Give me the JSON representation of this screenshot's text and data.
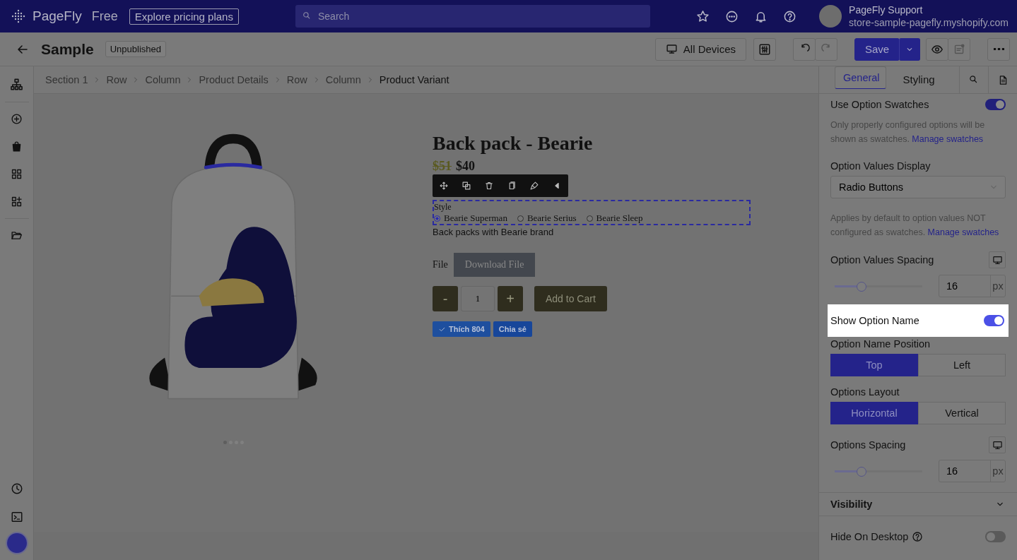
{
  "topbar": {
    "logo": "PageFly",
    "plan": "Free",
    "pricing_button": "Explore pricing plans",
    "search": {
      "placeholder": "Search"
    },
    "user": {
      "name": "PageFly Support",
      "store": "store-sample-pagefly.myshopify.com"
    }
  },
  "toolbar": {
    "page_title": "Sample",
    "status": "Unpublished",
    "device_button": "All Devices",
    "save_button": "Save"
  },
  "breadcrumb": [
    "Section 1",
    "Row",
    "Column",
    "Product Details",
    "Row",
    "Column",
    "Product Variant"
  ],
  "product": {
    "title": "Back pack - Bearie",
    "compare_price": "$51",
    "price": "$40",
    "option_name": "Style",
    "options": [
      {
        "label": "Bearie Superman",
        "selected": true
      },
      {
        "label": "Bearie Serius",
        "selected": false
      },
      {
        "label": "Bearie Sleep",
        "selected": false
      }
    ],
    "description": "Back packs with Bearie brand",
    "file_label": "File",
    "download_button": "Download File",
    "minus": "-",
    "quantity": "1",
    "plus": "+",
    "add_to_cart": "Add to Cart",
    "like_button": "Thích 804",
    "share_button": "Chia sẻ",
    "gallery_dots": [
      {
        "selected": true
      },
      {
        "selected": false
      },
      {
        "selected": false
      },
      {
        "selected": false
      }
    ]
  },
  "panel": {
    "tabs": [
      {
        "label": "General",
        "selected": true
      },
      {
        "label": "Styling",
        "selected": false
      }
    ],
    "settings": [
      {
        "kind": "toggle",
        "label": "Use Option Swatches",
        "on": true,
        "highlighted": false
      },
      {
        "kind": "note",
        "text": "Only properly configured options will be shown as swatches.",
        "link": "Manage swatches"
      },
      {
        "kind": "select",
        "label": "Option Values Display",
        "value": "Radio Buttons"
      },
      {
        "kind": "note",
        "text": "Applies by default to option values NOT configured as swatches.",
        "link": "Manage swatches"
      },
      {
        "kind": "slider",
        "label": "Option Values Spacing",
        "level": 0.3,
        "value": "16",
        "unit": "px"
      },
      {
        "kind": "toggle",
        "label": "Show Option Name",
        "on": true,
        "highlighted": true
      },
      {
        "kind": "segmented",
        "label": "Option Name Position",
        "options": [
          {
            "label": "Top",
            "selected": true
          },
          {
            "label": "Left",
            "selected": false
          }
        ]
      },
      {
        "kind": "segmented",
        "label": "Options Layout",
        "options": [
          {
            "label": "Horizontal",
            "selected": true
          },
          {
            "label": "Vertical",
            "selected": false
          }
        ]
      },
      {
        "kind": "slider",
        "label": "Options Spacing",
        "level": 0.3,
        "value": "16",
        "unit": "px"
      },
      {
        "kind": "section",
        "label": "Visibility"
      },
      {
        "kind": "toggle",
        "label": "Hide On Desktop",
        "on": false,
        "highlighted": false,
        "help": true
      }
    ]
  }
}
